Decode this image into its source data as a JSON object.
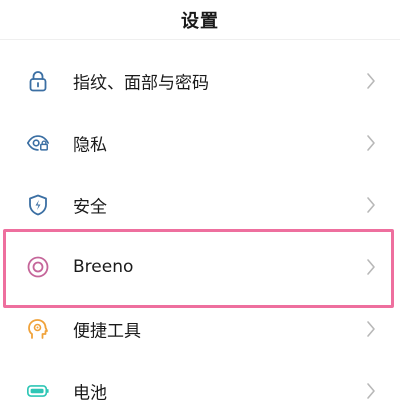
{
  "header": {
    "title": "设置"
  },
  "settings": {
    "items": [
      {
        "label": "指纹、面部与密码",
        "icon": "lock-icon"
      },
      {
        "label": "隐私",
        "icon": "privacy-eye-icon"
      },
      {
        "label": "安全",
        "icon": "shield-bolt-icon"
      },
      {
        "label": "Breeno",
        "icon": "breeno-circle-icon"
      },
      {
        "label": "便捷工具",
        "icon": "head-gear-icon"
      },
      {
        "label": "电池",
        "icon": "battery-icon"
      }
    ]
  },
  "colors": {
    "icon_blue": "#3b6fa3",
    "breeno_pink": "#c5669a",
    "tools_orange": "#f0a23a",
    "battery_teal": "#2fc6b5",
    "highlight_border": "#ee6f9e",
    "chevron": "#b8b8b8"
  }
}
